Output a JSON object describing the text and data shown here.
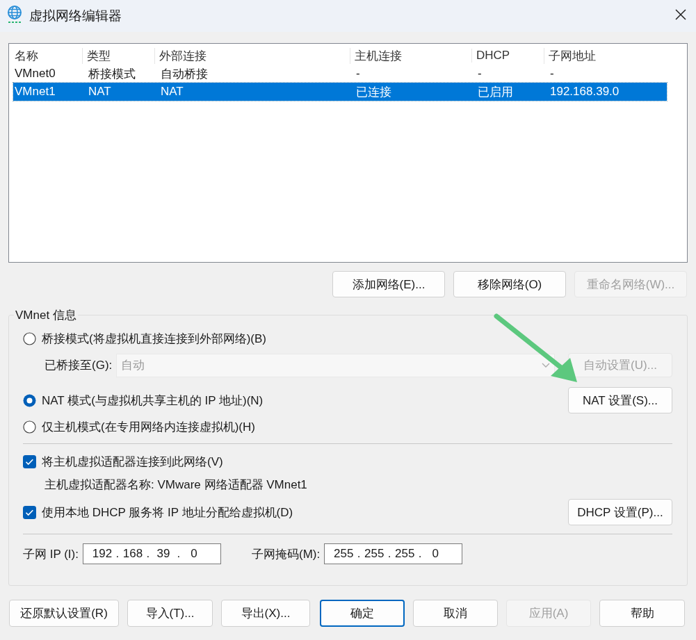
{
  "window": {
    "title": "虚拟网络编辑器"
  },
  "network_table": {
    "columns": [
      "名称",
      "类型",
      "外部连接",
      "主机连接",
      "DHCP",
      "子网地址"
    ],
    "rows": [
      {
        "cells": [
          "VMnet0",
          "桥接模式",
          "自动桥接",
          "-",
          "-",
          "-"
        ],
        "selected": false
      },
      {
        "cells": [
          "VMnet1",
          "NAT",
          "NAT",
          "已连接",
          "已启用",
          "192.168.39.0"
        ],
        "selected": true
      }
    ]
  },
  "network_buttons": [
    {
      "label": "添加网络(E)...",
      "disabled": false
    },
    {
      "label": "移除网络(O)",
      "disabled": false
    },
    {
      "label": "重命名网络(W)...",
      "disabled": true
    }
  ],
  "vmnet_info": {
    "title": "VMnet 信息",
    "modes": [
      {
        "label": "桥接模式(将虚拟机直接连接到外部网络)(B)",
        "selected": false
      },
      {
        "label": "NAT 模式(与虚拟机共享主机的 IP 地址)(N)",
        "selected": true
      },
      {
        "label": "仅主机模式(在专用网络内连接虚拟机)(H)",
        "selected": false
      }
    ],
    "bridged_to": {
      "label": "已桥接至(G):",
      "value": "自动",
      "disabled": true
    },
    "auto_settings_button": {
      "label": "自动设置(U)...",
      "disabled": true
    },
    "nat_settings_button": {
      "label": "NAT 设置(S)...",
      "disabled": false
    },
    "host_adapter": {
      "label": "将主机虚拟适配器连接到此网络(V)",
      "checked": true
    },
    "adapter_name": "主机虚拟适配器名称: VMware 网络适配器 VMnet1",
    "dhcp": {
      "label": "使用本地 DHCP 服务将 IP 地址分配给虚拟机(D)",
      "checked": true
    },
    "dhcp_settings_button": {
      "label": "DHCP 设置(P)...",
      "disabled": false
    },
    "subnet_ip": {
      "label": "子网 IP (I):",
      "parts": [
        "192",
        ".",
        "168",
        ".",
        "39",
        ".",
        "0"
      ]
    },
    "subnet_mask": {
      "label": "子网掩码(M):",
      "parts": [
        "255",
        ".",
        "255",
        ".",
        "255",
        ".",
        "0"
      ]
    }
  },
  "footer_buttons": [
    {
      "label": "还原默认设置(R)",
      "disabled": false,
      "default": false
    },
    {
      "label": "导入(T)...",
      "disabled": false,
      "default": false
    },
    {
      "label": "导出(X)...",
      "disabled": false,
      "default": false
    },
    {
      "label": "确定",
      "disabled": false,
      "default": true
    },
    {
      "label": "取消",
      "disabled": false,
      "default": false
    },
    {
      "label": "应用(A)",
      "disabled": true,
      "default": false
    },
    {
      "label": "帮助",
      "disabled": false,
      "default": false
    }
  ]
}
